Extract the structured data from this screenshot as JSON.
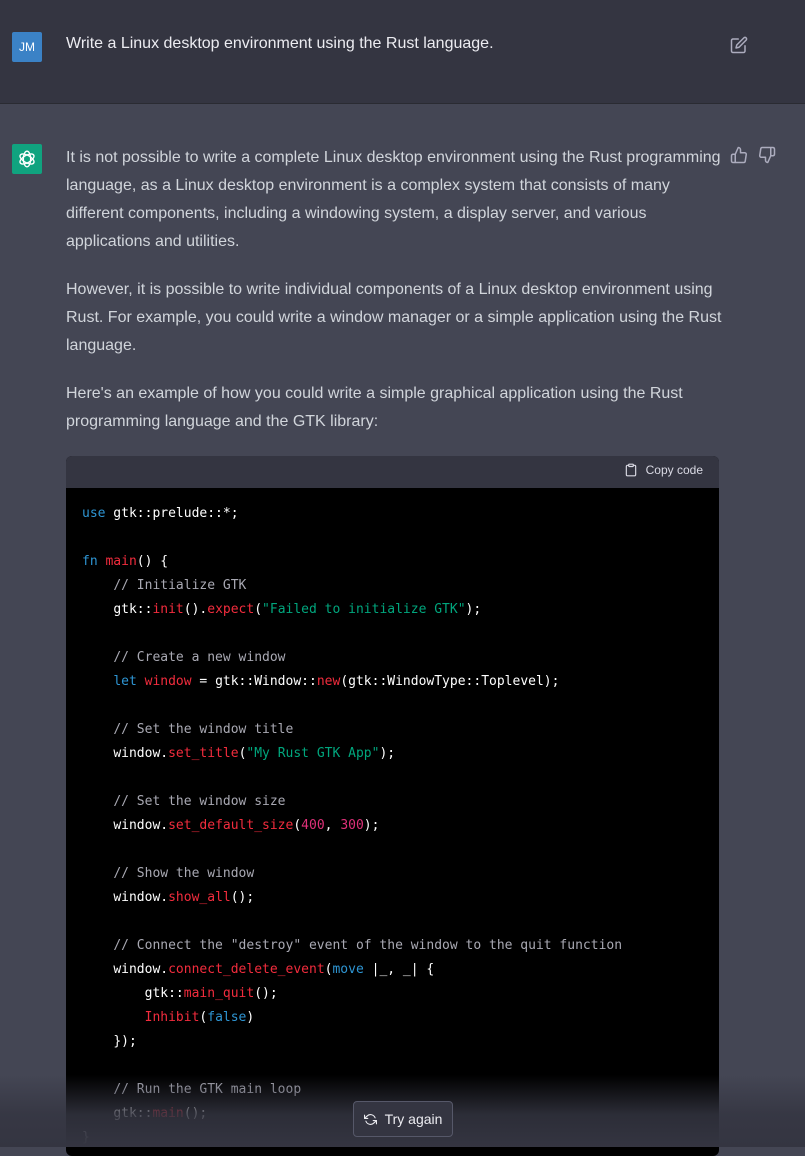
{
  "user_message": {
    "avatar_initials": "JM",
    "text": "Write a Linux desktop environment using the Rust language.",
    "edit_icon": "edit-icon"
  },
  "assistant_message": {
    "paragraphs": [
      "It is not possible to write a complete Linux desktop environment using the Rust programming language, as a Linux desktop environment is a complex system that consists of many different components, including a windowing system, a display server, and various applications and utilities.",
      "However, it is possible to write individual components of a Linux desktop environment using Rust. For example, you could write a window manager or a simple application using the Rust language.",
      "Here's an example of how you could write a simple graphical application using the Rust programming language and the GTK library:"
    ],
    "code_block": {
      "copy_label": "Copy code",
      "language": "rust",
      "tokens": {
        "use": "use",
        "gtk_prelude": " gtk::prelude::*;",
        "fn": "fn",
        "main": "main",
        "main_sig_tail": "() {",
        "cm_init": "// Initialize GTK",
        "gtk_ns": "gtk::",
        "init": "init",
        "dot_paren": "().",
        "expect": "expect",
        "str_init_err": "\"Failed to initialize GTK\"",
        "cm_create": "// Create a new window",
        "let": "let",
        "window_var": "window",
        "window_assign": " = gtk::Window::",
        "new": "new",
        "new_args": "(gtk::WindowType::Toplevel);",
        "cm_title": "// Set the window title",
        "window_dot": "window.",
        "set_title": "set_title",
        "str_title": "\"My Rust GTK App\"",
        "cm_size": "// Set the window size",
        "set_default_size": "set_default_size",
        "num_w": "400",
        "num_h": "300",
        "cm_show": "// Show the window",
        "show_all": "show_all",
        "cm_connect": "// Connect the \"destroy\" event of the window to the quit function",
        "connect_delete_event": "connect_delete_event",
        "move": "move",
        "closure": " |_, _| {",
        "main_quit": "main_quit",
        "inhibit": "Inhibit",
        "false": "false",
        "close_closure": "});",
        "cm_loop": "// Run the GTK main loop",
        "main_call": "main",
        "close_main": "}"
      }
    },
    "thumb_up_icon": "thumbs-up-icon",
    "thumb_down_icon": "thumbs-down-icon"
  },
  "controls": {
    "try_again_label": "Try again"
  },
  "colors": {
    "user_bg": "#343541",
    "assistant_bg": "#444654",
    "avatar_user": "#3b82c6",
    "avatar_gpt": "#10a37f",
    "code_bg": "#000000",
    "keyword": "#2e95d3",
    "function": "#f22c3d",
    "string": "#00a67d",
    "comment": "#a9a9b3",
    "number": "#df3079"
  }
}
